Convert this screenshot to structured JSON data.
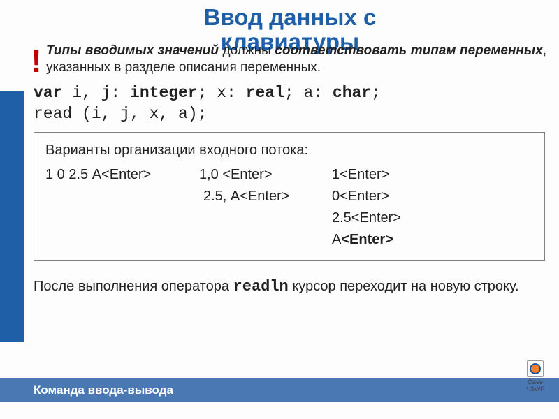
{
  "title_l1": "Ввод данных с",
  "title_l2": "клавиатуры",
  "warn": {
    "excl": "!",
    "p1_i_b": "Типы вводимых значений",
    "p1_mid": " должны ",
    "p1_b": "соответствовать типам переменных",
    "p1_tail": ", указанных в разделе описания переменных."
  },
  "code": {
    "line1_a": "var",
    "line1_b": " i, j: ",
    "line1_c": "integer",
    "line1_d": "; x: ",
    "line1_e": "real",
    "line1_f": "; a: ",
    "line1_g": "char",
    "line1_h": ";",
    "line2": "read (i, j, x, a);"
  },
  "box": {
    "title": "Варианты организации входного потока:",
    "col1_r1": "1 0 2.5 А<Enter>",
    "col2_r1": "1,0  <Enter>",
    "col2_r2": "2.5, А<Enter>",
    "col3_r1": "1<Enter>",
    "col3_r2": "0<Enter>",
    "col3_r3": "2.5<Enter>",
    "col3_r4_a": "А",
    "col3_r4_b": "<Enter>"
  },
  "after": {
    "a": "После выполнения оператора  ",
    "b": "readln",
    "c": "   курсор переходит на новую строку."
  },
  "footer": "Команда ввода-вывода",
  "corner_label": "Ôàéë *.SWF"
}
